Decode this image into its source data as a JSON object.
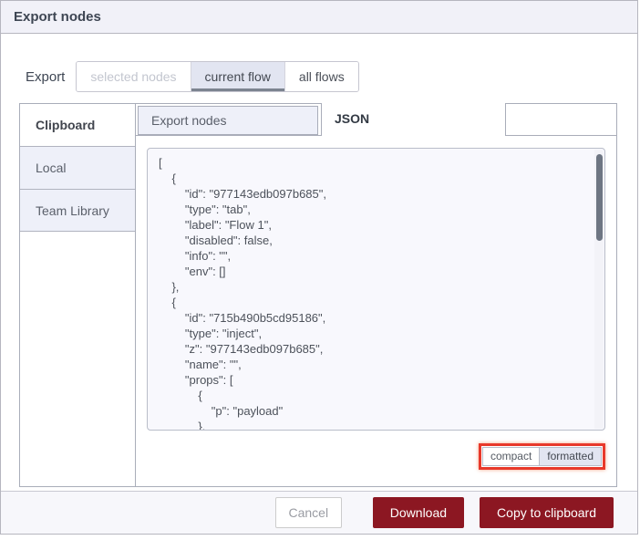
{
  "dialog": {
    "title": "Export nodes",
    "export_row": {
      "label": "Export",
      "options": [
        {
          "label": "selected nodes",
          "state": "disabled"
        },
        {
          "label": "current flow",
          "state": "selected"
        },
        {
          "label": "all flows",
          "state": "normal"
        }
      ]
    },
    "sidebar": {
      "header": "Clipboard",
      "items": [
        {
          "label": "Local"
        },
        {
          "label": "Team Library"
        }
      ]
    },
    "tabs": [
      {
        "label": "Export nodes",
        "active": false
      },
      {
        "label": "JSON",
        "active": true
      }
    ],
    "json_preview": "[\n    {\n        \"id\": \"977143edb097b685\",\n        \"type\": \"tab\",\n        \"label\": \"Flow 1\",\n        \"disabled\": false,\n        \"info\": \"\",\n        \"env\": []\n    },\n    {\n        \"id\": \"715b490b5cd95186\",\n        \"type\": \"inject\",\n        \"z\": \"977143edb097b685\",\n        \"name\": \"\",\n        \"props\": [\n            {\n                \"p\": \"payload\"\n            },",
    "format_toggle": {
      "options": [
        {
          "label": "compact",
          "selected": false
        },
        {
          "label": "formatted",
          "selected": true
        }
      ],
      "highlight_color": "#e8392b"
    },
    "footer": {
      "cancel_label": "Cancel",
      "download_label": "Download",
      "copy_label": "Copy to clipboard",
      "primary_color": "#8c1722"
    }
  }
}
